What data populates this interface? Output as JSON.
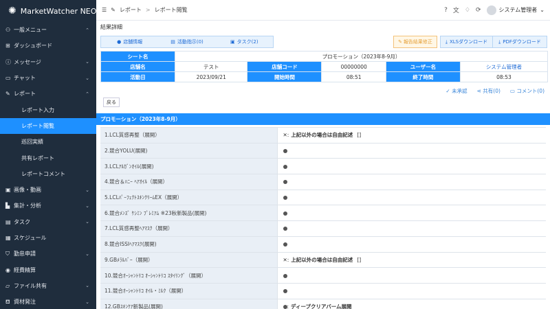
{
  "app": {
    "name": "MarketWatcher NEO"
  },
  "sidebar": {
    "items": [
      {
        "label": "一般メニュー",
        "icon": "people-icon",
        "expanded": true
      },
      {
        "label": "ダッシュボード",
        "icon": "grid-icon"
      },
      {
        "label": "メッセージ",
        "icon": "info-icon"
      },
      {
        "label": "チャット",
        "icon": "chat-icon"
      },
      {
        "label": "レポート",
        "icon": "pen-icon",
        "expanded": true
      },
      {
        "label": "レポート入力",
        "sub": true
      },
      {
        "label": "レポート閲覧",
        "sub": true,
        "active": true
      },
      {
        "label": "巡回実績",
        "sub": true
      },
      {
        "label": "共有レポート",
        "sub": true
      },
      {
        "label": "レポートコメント",
        "sub": true
      },
      {
        "label": "画像・動画",
        "icon": "image-icon"
      },
      {
        "label": "集計・分析",
        "icon": "chart-icon"
      },
      {
        "label": "タスク",
        "icon": "task-icon"
      },
      {
        "label": "スケジュール",
        "icon": "calendar-icon"
      },
      {
        "label": "勤怠申請",
        "icon": "shield-icon"
      },
      {
        "label": "経費精算",
        "icon": "coin-icon"
      },
      {
        "label": "ファイル共有",
        "icon": "folder-icon"
      },
      {
        "label": "資材発注",
        "icon": "cart-icon"
      }
    ]
  },
  "topbar": {
    "breadcrumb": [
      "レポート",
      "レポート閲覧"
    ],
    "user": "システム管理者"
  },
  "main": {
    "section_title": "結果詳細",
    "tabs": [
      {
        "label": "店舗情報",
        "icon": "store-icon"
      },
      {
        "label": "活動指示(0)",
        "icon": "list-icon"
      },
      {
        "label": "タスク(2)",
        "icon": "task-icon"
      }
    ],
    "review_button": "報告結果修正",
    "xls_button": "XLSダウンロード",
    "pdf_button": "PDFダウンロード",
    "info": {
      "sheet_label": "シート名",
      "sheet_value": "プロモーション（2023年8-9月）",
      "store_label": "店舗名",
      "store_value": "テスト",
      "store_code_label": "店舗コード",
      "store_code_value": "00000000",
      "user_label": "ユーザー名",
      "user_value": "システム管理者",
      "date_label": "活動日",
      "date_value": "2023/09/21",
      "start_label": "開始時間",
      "start_value": "08:51",
      "end_label": "終了時間",
      "end_value": "08:53"
    },
    "actions": {
      "unapproved": "未承認",
      "shared": "共有(0)",
      "comment": "コメント(0)"
    },
    "back_button": "戻る",
    "promo_header": "プロモーション（2023年8-9月）",
    "questions": [
      {
        "label": "1.LCL質感再整（展開）",
        "type": "cross",
        "answer": "上記以外の場合は自由記述",
        "extra": "[]"
      },
      {
        "label": "2.競合YOLU(展開)",
        "type": "dot"
      },
      {
        "label": "3.LCLｱﾙｶﾞﾝｵｲﾙ(展開)",
        "type": "dot"
      },
      {
        "label": "4.競合＆ﾊﾆｰ ﾍｱｵｲﾙ（展開）",
        "type": "dot"
      },
      {
        "label": "5.LCLﾊﾟｰﾌｪｸﾄｽｷﾝｸﾘｰﾑEX（展開）",
        "type": "dot"
      },
      {
        "label": "6.競合ﾒﾝｽﾞ ｹｼﾐﾝ ﾌﾟﾚﾐｱﾑ ※23秋新製品(展開)",
        "type": "dot"
      },
      {
        "label": "7.LCL質感再整ﾍｱﾏｽｸ（展開）",
        "type": "dot"
      },
      {
        "label": "8.競合ISSIﾍｱﾏｽｸ(展開)",
        "type": "dot"
      },
      {
        "label": "9.GBﾒﾗﾙﾊﾞｰ（展開）",
        "type": "cross",
        "answer": "上記以外の場合は自由記述",
        "extra": "[]"
      },
      {
        "label": "10.競合ｵｰｼｬﾝﾄﾘｺ ｵｰｼｬﾝﾄﾘｺ ｽﾀｲﾘﾝｸﾞ（展開）",
        "type": "dot"
      },
      {
        "label": "11.競合ｵｰｼｬﾝﾄﾘｺ ｵｲﾙ・ﾐﾙｸ（展開）",
        "type": "dot"
      },
      {
        "label": "12.GBｽｷﾝｹｱ新製品(展開)",
        "type": "dot",
        "answer": "ディープクリアバーム展開"
      }
    ]
  },
  "colors": {
    "accent": "#1e90ff",
    "sidebar": "#1f2d3d",
    "warning": "#e6a23c"
  }
}
